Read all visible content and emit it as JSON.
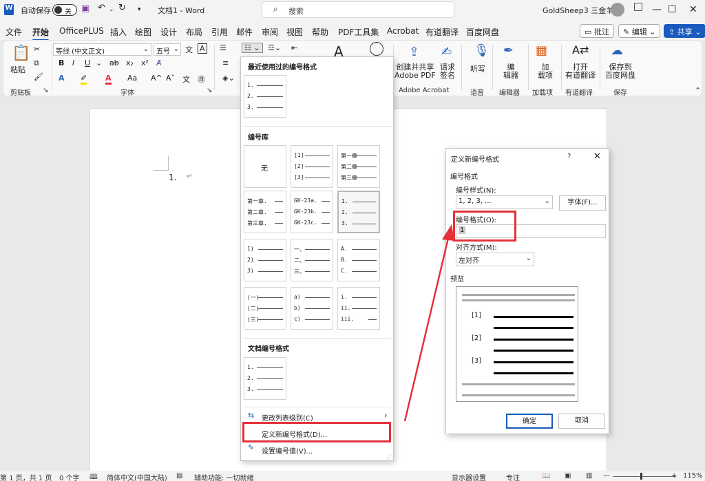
{
  "titlebar": {
    "autosave_label": "自动保存",
    "autosave_state": "关",
    "doc_title": "文档1  -  Word",
    "search_placeholder": "搜索",
    "user": "GoldSheep3 三金羊"
  },
  "tabs": [
    "文件",
    "开始",
    "OfficePLUS",
    "插入",
    "绘图",
    "设计",
    "布局",
    "引用",
    "邮件",
    "审阅",
    "视图",
    "帮助",
    "PDF工具集",
    "Acrobat",
    "有道翻译",
    "百度网盘"
  ],
  "tab_actions": {
    "comment": "批注",
    "edit": "编辑",
    "share": "共享"
  },
  "ribbon": {
    "paste": "粘贴",
    "clipboard": "剪贴板",
    "font_name": "等线 (中文正文)",
    "font_size": "五号",
    "font_group": "字体",
    "create_pdf": "创建并共享\nAdobe PDF",
    "request_sign": "请求\n签名",
    "adobe_group": "Adobe Acrobat",
    "dictate": "听写",
    "voice_group": "语音",
    "editor": "编\n辑器",
    "editor_group": "编辑器",
    "addins": "加\n载项",
    "addins_group": "加载项",
    "open_translate": "打开\n有道翻译",
    "youdao_group": "有道翻译",
    "save_baidu": "保存到\n百度网盘",
    "save_group": "保存"
  },
  "document": {
    "list_marker": "1."
  },
  "dropdown": {
    "recent_header": "最近使用过的编号格式",
    "library_header": "编号库",
    "doc_header": "文档编号格式",
    "none_label": "无",
    "cells": [
      [
        "[1]",
        "[2]",
        "[3]"
      ],
      [
        "第一章",
        "第二章",
        "第三章"
      ],
      [
        "第一章.",
        "第二章.",
        "第三章."
      ],
      [
        "GK-23a.",
        "GK-23b.",
        "GK-23c."
      ],
      [
        "1.",
        "2.",
        "3."
      ],
      [
        "1)",
        "2)",
        "3)"
      ],
      [
        "一、",
        "二、",
        "三、"
      ],
      [
        "A.",
        "B.",
        "C."
      ],
      [
        "(一)",
        "(二)",
        "(三)"
      ],
      [
        "a)",
        "b)",
        "c)"
      ],
      [
        "i.",
        "ii.",
        "iii."
      ]
    ],
    "recent_cell": [
      "1.",
      "2.",
      "3."
    ],
    "doc_cell": [
      "1.",
      "2.",
      "3."
    ],
    "change_level": "更改列表级别(C)",
    "define_new": "定义新编号格式(D)...",
    "set_value": "设置编号值(V)..."
  },
  "dialog": {
    "title": "定义新编号格式",
    "help": "?",
    "section": "编号格式",
    "style_label": "编号样式(N):",
    "style_value": "1, 2, 3, ...",
    "font_button": "字体(F)...",
    "format_label": "编号格式(O):",
    "format_value": "1",
    "align_label": "对齐方式(M):",
    "align_value": "左对齐",
    "preview_label": "预览",
    "preview_items": [
      "[1]",
      "[2]",
      "[3]"
    ],
    "ok": "确定",
    "cancel": "取消"
  },
  "status": {
    "page": "第 1 页，共 1 页",
    "words": "0 个字",
    "lang": "简体中文(中国大陆)",
    "accessibility": "辅助功能: 一切就绪",
    "display": "显示器设置",
    "focus": "专注",
    "zoom": "115%"
  },
  "colors": {
    "accent": "#185abd",
    "highlight": "#e5303a"
  }
}
